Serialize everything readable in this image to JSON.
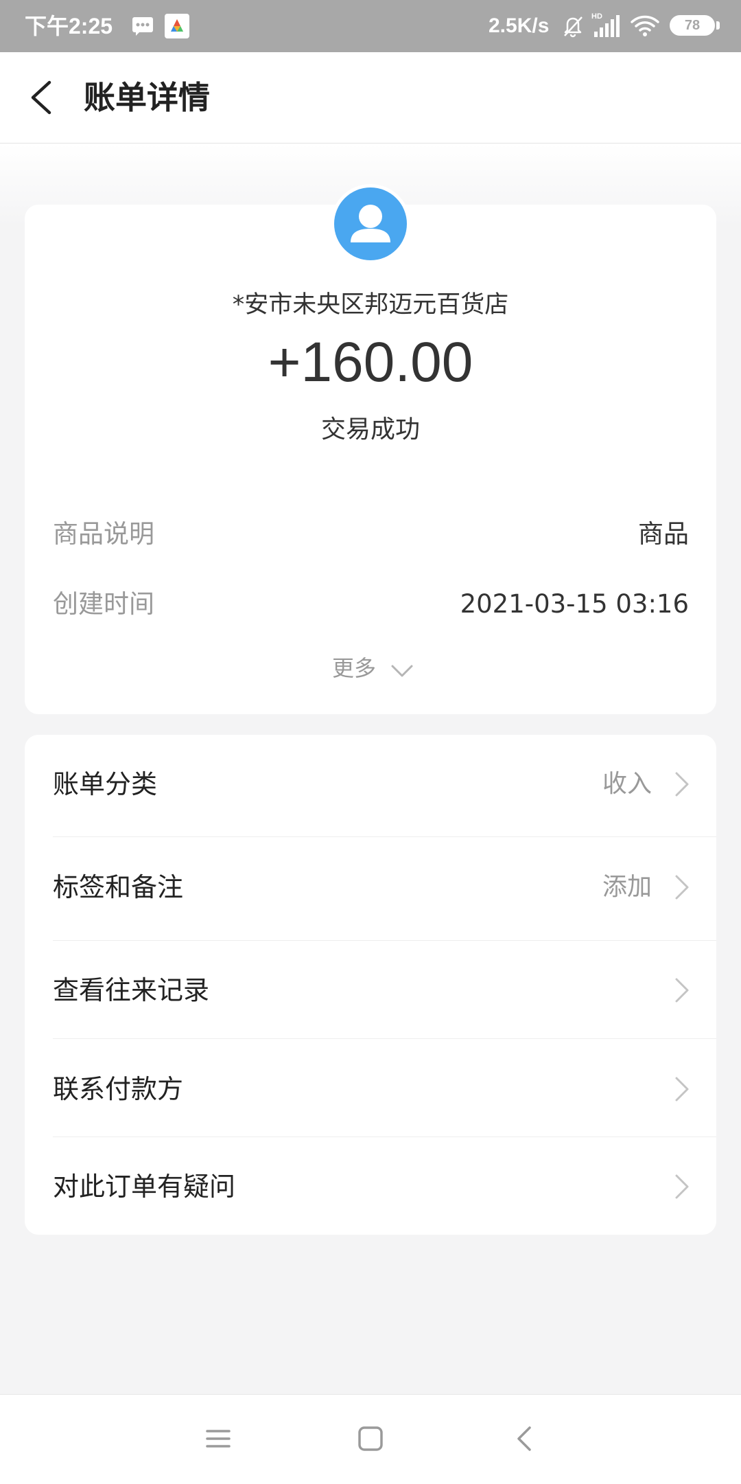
{
  "status_bar": {
    "time": "下午2:25",
    "network_speed": "2.5K/s",
    "network_label": "HD",
    "battery": "78",
    "icons": [
      "message-icon",
      "app-icon",
      "bell-muted-icon",
      "signal-icon",
      "wifi-icon",
      "battery-icon"
    ]
  },
  "header": {
    "title": "账单详情",
    "back_icon": "chevron-left-icon"
  },
  "summary": {
    "avatar_icon": "user-avatar-icon",
    "merchant": "*安市未央区邦迈元百货店",
    "amount": "+160.00",
    "status": "交易成功",
    "details": [
      {
        "label": "商品说明",
        "value": "商品"
      },
      {
        "label": "创建时间",
        "value": "2021-03-15 03:16"
      }
    ],
    "more_label": "更多",
    "more_icon": "chevron-down-icon"
  },
  "actions": [
    {
      "label": "账单分类",
      "value": "收入"
    },
    {
      "label": "标签和备注",
      "value": "添加"
    },
    {
      "label": "查看往来记录",
      "value": ""
    },
    {
      "label": "联系付款方",
      "value": ""
    },
    {
      "label": "对此订单有疑问",
      "value": ""
    }
  ],
  "nav_bar": {
    "icons": [
      "menu-icon",
      "home-icon",
      "back-icon"
    ]
  },
  "colors": {
    "status_bar_bg": "#a8a8a8",
    "avatar_blue": "#4aa7f0",
    "page_bg": "#f4f4f5",
    "text_primary": "#333333",
    "text_secondary": "#999999"
  }
}
